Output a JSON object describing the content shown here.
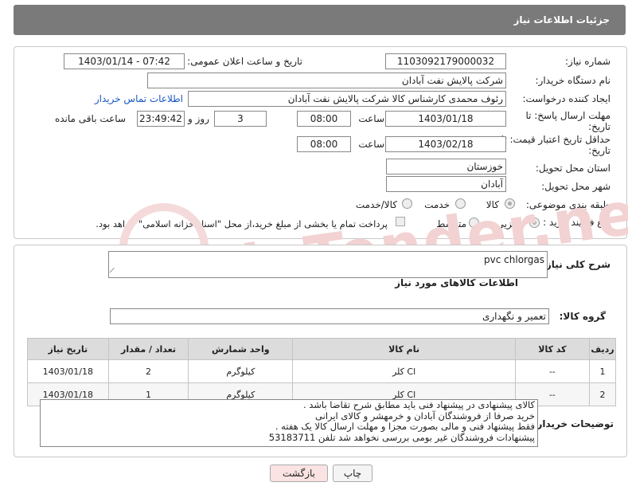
{
  "header": {
    "title": "جزئیات اطلاعات نیاز"
  },
  "need": {
    "number_label": "شماره نیاز:",
    "number": "1103092179000032",
    "announce_label": "تاریخ و ساعت اعلان عمومی:",
    "announce": "1403/01/14 - 07:42",
    "buyer_label": "نام دستگاه خریدار:",
    "buyer": "شرکت پالایش نفت آبادان",
    "creator_label": "ایجاد کننده درخواست:",
    "creator": "رئوف محمدی کارشناس کالا شرکت پالایش نفت آبادان",
    "contact_link": "اطلاعات تماس خریدار",
    "reply_label_1": "مهلت ارسال پاسخ: تا",
    "reply_label_2": "تاریخ:",
    "reply_date": "1403/01/18",
    "time_label": "ساعت",
    "reply_time": "08:00",
    "days_value": "3",
    "days_label": "روز و",
    "remaining": "23:49:42",
    "remaining_label": "ساعت باقی مانده",
    "validity_label_1": "حداقل تاریخ اعتبار قیمت: تا",
    "validity_label_2": "تاریخ:",
    "validity_date": "1403/02/18",
    "validity_time": "08:00",
    "province_label": "استان محل تحویل:",
    "province": "خوزستان",
    "city_label": "شهر محل تحویل:",
    "city": "آبادان",
    "category_label": "طبقه بندی موضوعی:",
    "category_options": [
      "کالا",
      "خدمت",
      "کالا/خدمت"
    ],
    "process_label": "نوع فرآیند خرید :",
    "process_options": [
      "جزیی",
      "متوسط"
    ],
    "payment_note": "پرداخت تمام یا بخشی از مبلغ خرید،از محل \"اسناد خزانه اسلامی\" خواهد بود."
  },
  "watermark": "AriaTender.neT",
  "details": {
    "description_label": "شرح کلی نیاز:",
    "description": "pvc chlorgas",
    "goods_title": "اطلاعات کالاهای مورد نیاز",
    "group_label": "گروه کالا:",
    "group": "تعمیر و نگهداری"
  },
  "table": {
    "headers": [
      "ردیف",
      "کد کالا",
      "نام کالا",
      "واحد شمارش",
      "تعداد / مقدار",
      "تاریخ نیاز"
    ],
    "rows": [
      [
        "1",
        "--",
        "کلر Cl",
        "کیلوگرم",
        "2",
        "1403/01/18"
      ],
      [
        "2",
        "--",
        "کلر Cl",
        "کیلوگرم",
        "1",
        "1403/01/18"
      ]
    ]
  },
  "notes": {
    "label": "توضیحات خریدار:",
    "lines": [
      "کالای پیشنهادی در پیشنهاد فنی باید مطابق شرح تقاضا باشد .",
      "خرید صرفا از فروشندگان  آبادان و خرمهشر و کالای ایرانی",
      " فقط پیشنهاد فنی و مالی بصورت مجزا و مهلت ارسال کالا یک هفته .",
      "پیشنهادات فروشندگان غیر بومی بررسی نخواهد شد تلفن 53183711"
    ]
  },
  "buttons": {
    "print": "چاپ",
    "back": "بازگشت"
  }
}
